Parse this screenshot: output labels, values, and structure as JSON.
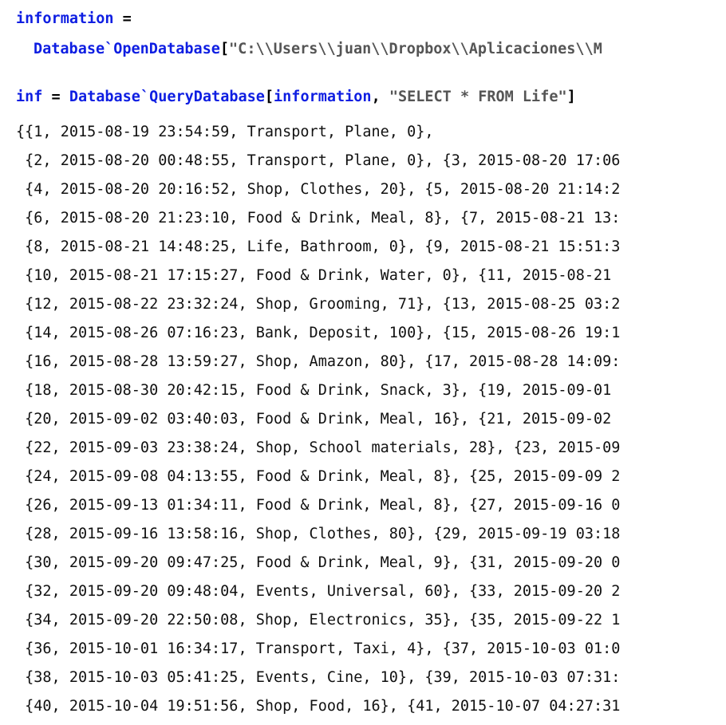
{
  "input1": {
    "var": "information",
    "op": " =",
    "fn": "Database`OpenDatabase",
    "open": "[",
    "arg": "\"C:\\\\Users\\\\juan\\\\Dropbox\\\\Aplicaciones\\\\M"
  },
  "input2": {
    "var": "inf",
    "op": " = ",
    "fn": "Database`QueryDatabase",
    "open": "[",
    "arg1": "information",
    "comma": ", ",
    "arg2": "\"SELECT * FROM Life\"",
    "close": "]"
  },
  "output_lines": [
    "{{1, 2015-08-19 23:54:59, Transport, Plane, 0},",
    " {2, 2015-08-20 00:48:55, Transport, Plane, 0}, {3, 2015-08-20 17:06",
    " {4, 2015-08-20 20:16:52, Shop, Clothes, 20}, {5, 2015-08-20 21:14:2",
    " {6, 2015-08-20 21:23:10, Food & Drink, Meal, 8}, {7, 2015-08-21 13:",
    " {8, 2015-08-21 14:48:25, Life, Bathroom, 0}, {9, 2015-08-21 15:51:3",
    " {10, 2015-08-21 17:15:27, Food & Drink, Water, 0}, {11, 2015-08-21 ",
    " {12, 2015-08-22 23:32:24, Shop, Grooming, 71}, {13, 2015-08-25 03:2",
    " {14, 2015-08-26 07:16:23, Bank, Deposit, 100}, {15, 2015-08-26 19:1",
    " {16, 2015-08-28 13:59:27, Shop, Amazon, 80}, {17, 2015-08-28 14:09:",
    " {18, 2015-08-30 20:42:15, Food & Drink, Snack, 3}, {19, 2015-09-01 ",
    " {20, 2015-09-02 03:40:03, Food & Drink, Meal, 16}, {21, 2015-09-02 ",
    " {22, 2015-09-03 23:38:24, Shop, School materials, 28}, {23, 2015-09",
    " {24, 2015-09-08 04:13:55, Food & Drink, Meal, 8}, {25, 2015-09-09 2",
    " {26, 2015-09-13 01:34:11, Food & Drink, Meal, 8}, {27, 2015-09-16 0",
    " {28, 2015-09-16 13:58:16, Shop, Clothes, 80}, {29, 2015-09-19 03:18",
    " {30, 2015-09-20 09:47:25, Food & Drink, Meal, 9}, {31, 2015-09-20 0",
    " {32, 2015-09-20 09:48:04, Events, Universal, 60}, {33, 2015-09-20 2",
    " {34, 2015-09-20 22:50:08, Shop, Electronics, 35}, {35, 2015-09-22 1",
    " {36, 2015-10-01 16:34:17, Transport, Taxi, 4}, {37, 2015-10-03 01:0",
    " {38, 2015-10-03 05:41:25, Events, Cine, 10}, {39, 2015-10-03 07:31:",
    " {40, 2015-10-04 19:51:56, Shop, Food, 16}, {41, 2015-10-07 04:27:31"
  ]
}
